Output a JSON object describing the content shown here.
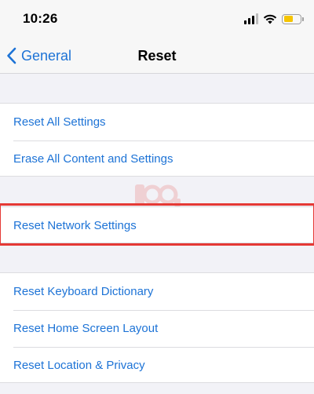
{
  "status_bar": {
    "time": "10:26",
    "icons": [
      "signal-icon",
      "wifi-icon",
      "battery-icon"
    ],
    "battery_level": 0.55,
    "battery_color": "#f5c400"
  },
  "nav": {
    "back_label": "General",
    "title": "Reset"
  },
  "groups": [
    {
      "items": [
        {
          "label": "Reset All Settings"
        },
        {
          "label": "Erase All Content and Settings"
        }
      ]
    },
    {
      "items": [
        {
          "label": "Reset Network Settings"
        }
      ]
    },
    {
      "items": [
        {
          "label": "Reset Keyboard Dictionary"
        },
        {
          "label": "Reset Home Screen Layout"
        },
        {
          "label": "Reset Location & Privacy"
        }
      ]
    }
  ],
  "colors": {
    "accent": "#1d73d6",
    "highlight": "#e53935",
    "background": "#f2f2f7"
  }
}
